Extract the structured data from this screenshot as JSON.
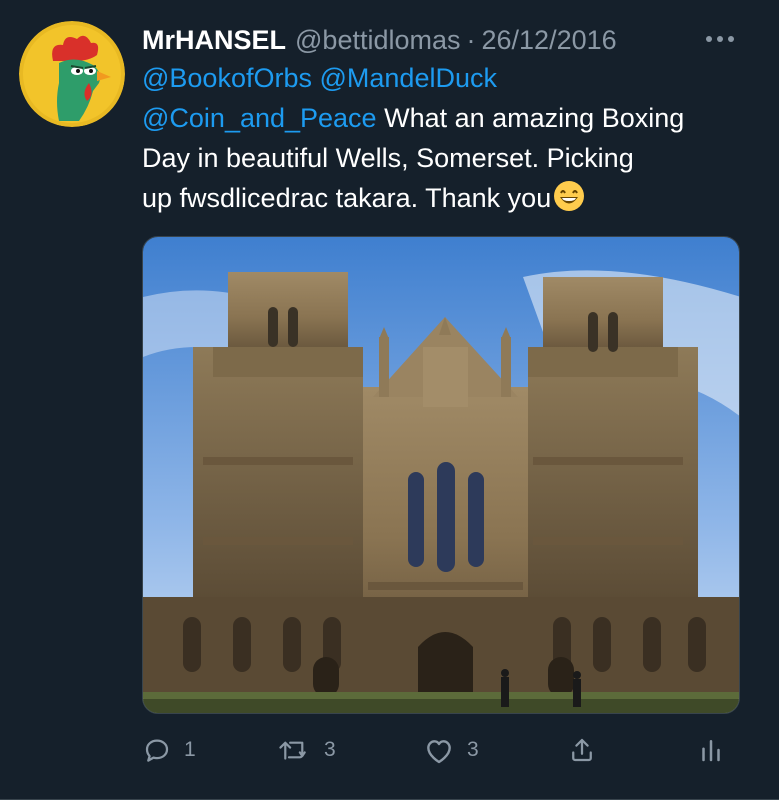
{
  "tweet": {
    "display_name": "MrHANSEL",
    "handle": "@bettidlomas",
    "separator": "·",
    "date": "26/12/2016",
    "text_lines": {
      "line1_mention1": "@BookofOrbs",
      "line1_mention2": "@MandelDuck",
      "line2_mention": "@Coin_and_Peace",
      "line2_text": " What an amazing Boxing",
      "line3_text": "Day in beautiful Wells, Somerset. Picking",
      "line4_text": "up fwsdlicedrac takara. Thank you"
    },
    "emoji": "grinning-face-emoji",
    "media": "photo of Wells Cathedral west front",
    "actions": {
      "reply_count": "1",
      "retweet_count": "3",
      "like_count": "3"
    }
  },
  "colors": {
    "background": "#15202b",
    "link": "#1d9bf0",
    "secondary_text": "#8b98a5",
    "divider": "#38444d"
  },
  "icons": [
    "more-icon",
    "reply-icon",
    "retweet-icon",
    "like-icon",
    "share-icon",
    "analytics-icon"
  ]
}
